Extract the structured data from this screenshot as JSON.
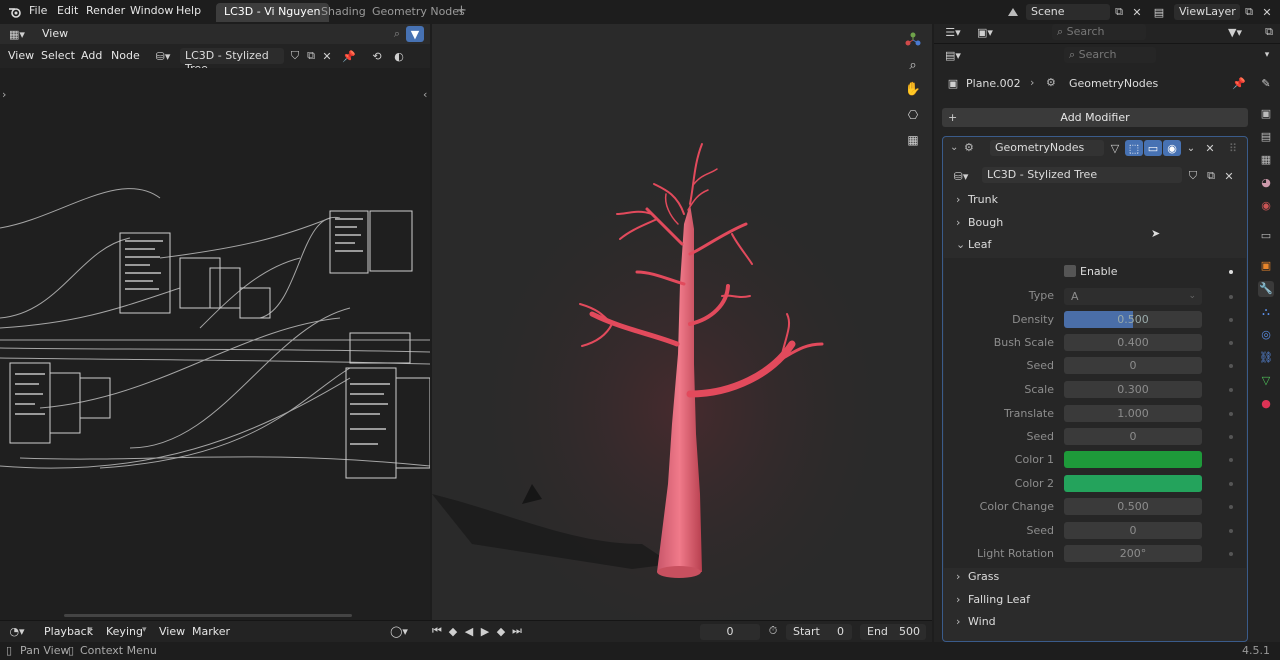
{
  "topbar": {
    "menus": [
      "File",
      "Edit",
      "Render",
      "Window",
      "Help"
    ],
    "workspace_tabs": [
      "LC3D - Vi Nguyen",
      "Shading",
      "Geometry Nodes"
    ],
    "add_tab": "+",
    "scene": "Scene",
    "view_layer": "ViewLayer"
  },
  "node_editor": {
    "header_view": "View",
    "menus": [
      "View",
      "Select",
      "Add",
      "Node"
    ],
    "node_tree_name": "LC3D - Stylized Tree"
  },
  "properties": {
    "search_placeholder_1": "Search",
    "search_placeholder_2": "Search",
    "breadcrumb_object": "Plane.002",
    "breadcrumb_modifier": "GeometryNodes",
    "add_modifier": "Add Modifier",
    "modifier_name": "GeometryNodes",
    "node_group": "LC3D - Stylized Tree",
    "sections": {
      "trunk": "Trunk",
      "bough": "Bough",
      "leaf": "Leaf",
      "grass": "Grass",
      "falling_leaf": "Falling Leaf",
      "wind": "Wind"
    },
    "leaf": {
      "enable_label": "Enable",
      "type_label": "Type",
      "type_value": "A",
      "density_label": "Density",
      "density_value": "0.500",
      "bush_scale_label": "Bush Scale",
      "bush_scale_value": "0.400",
      "seed1_label": "Seed",
      "seed1_value": "0",
      "scale_label": "Scale",
      "scale_value": "0.300",
      "translate_label": "Translate",
      "translate_value": "1.000",
      "seed2_label": "Seed",
      "seed2_value": "0",
      "color1_label": "Color 1",
      "color1": "#1e9a3a",
      "color2_label": "Color 2",
      "color2": "#24a35c",
      "color_change_label": "Color Change",
      "color_change_value": "0.500",
      "seed3_label": "Seed",
      "seed3_value": "0",
      "light_rotation_label": "Light Rotation",
      "light_rotation_value": "200°"
    }
  },
  "timeline": {
    "menus": [
      "Playback",
      "Keying",
      "View",
      "Marker"
    ],
    "current_frame": "0",
    "start_label": "Start",
    "start_value": "0",
    "end_label": "End",
    "end_value": "500"
  },
  "statusbar": {
    "pan_view": "Pan View",
    "context_menu": "Context Menu",
    "version": "4.5.1"
  },
  "colors": {
    "accent": "#4772b3",
    "tree": "#e04a5c",
    "bg": "#1d1d1d"
  }
}
